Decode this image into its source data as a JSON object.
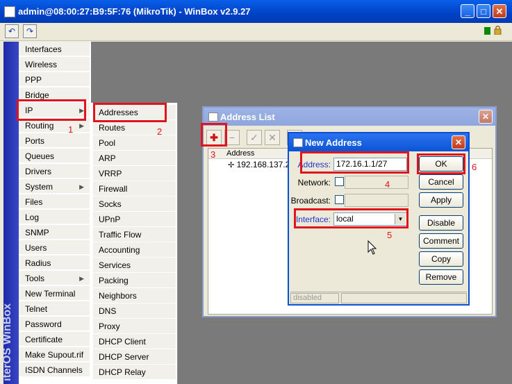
{
  "window": {
    "title": "admin@08:00:27:B9:5F:76 (MikroTik) - WinBox v2.9.27"
  },
  "strip_text": "iterOS WinBox",
  "menu": {
    "items": [
      "Interfaces",
      "Wireless",
      "PPP",
      "Bridge",
      "IP",
      "Routing",
      "Ports",
      "Queues",
      "Drivers",
      "System",
      "Files",
      "Log",
      "SNMP",
      "Users",
      "Radius",
      "Tools",
      "New Terminal",
      "Telnet",
      "Password",
      "Certificate",
      "Make Supout.rif",
      "ISDN Channels"
    ]
  },
  "submenu": {
    "items": [
      "Addresses",
      "Routes",
      "Pool",
      "ARP",
      "VRRP",
      "Firewall",
      "Socks",
      "UPnP",
      "Traffic Flow",
      "Accounting",
      "Services",
      "Packing",
      "Neighbors",
      "DNS",
      "Proxy",
      "DHCP Client",
      "DHCP Server",
      "DHCP Relay"
    ]
  },
  "address_list": {
    "title": "Address List",
    "column_header": "Address",
    "row_value": "192.168.137.2"
  },
  "new_address": {
    "title": "New Address",
    "address_label": "Address:",
    "address_value": "172.16.1.1/27",
    "network_label": "Network:",
    "broadcast_label": "Broadcast:",
    "interface_label": "Interface:",
    "interface_value": "local",
    "buttons": [
      "OK",
      "Cancel",
      "Apply",
      "Disable",
      "Comment",
      "Copy",
      "Remove"
    ],
    "status": "disabled"
  },
  "annotations": [
    "1",
    "2",
    "3",
    "4",
    "5",
    "6"
  ],
  "colors": {
    "title_blue": "#0a5ee8",
    "annotation_red": "#e0141c",
    "strip_blue": "#1d2aa8"
  }
}
